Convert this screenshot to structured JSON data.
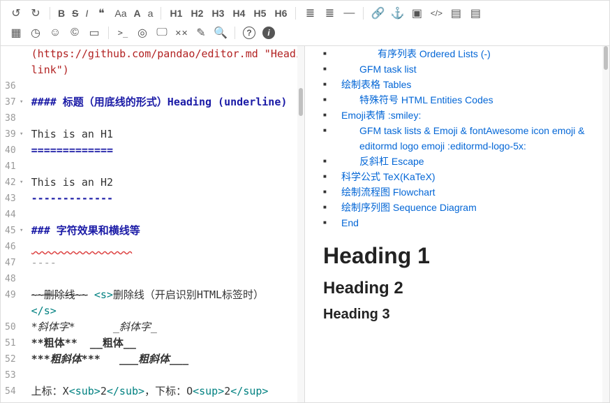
{
  "toolbar": {
    "undo": "↺",
    "redo": "↻",
    "bold": "B",
    "del": "S",
    "italic": "I",
    "quote": "❝",
    "ucwords": "Aa",
    "uppercase": "A",
    "lowercase": "a",
    "h1": "H1",
    "h2": "H2",
    "h3": "H3",
    "h4": "H4",
    "h5": "H5",
    "h6": "H6",
    "ul": "≣",
    "ol": "≣",
    "hr": "—",
    "link": "🔗",
    "anchor": "⚓",
    "image": "▣",
    "code": "</>",
    "codeblock": "▤",
    "codeblock2": "▤",
    "table": "▦",
    "datetime": "◷",
    "emoji": "☺",
    "copyright": "©",
    "htmlent": "▭",
    "goto": ">_",
    "watch": "◎",
    "preview": "🖵",
    "fullscreen": "✕✕",
    "clear": "✎",
    "search": "🔍",
    "help": "?",
    "info": "i"
  },
  "lines": [
    {
      "n": "",
      "fold": "",
      "parts": [
        {
          "cls": "c-link",
          "txt": "(https://github.com/pandao/editor.md \"Heading"
        }
      ]
    },
    {
      "n": "",
      "fold": "",
      "parts": [
        {
          "cls": "c-link",
          "txt": "link\")"
        }
      ]
    },
    {
      "n": "36",
      "fold": "",
      "parts": []
    },
    {
      "n": "37",
      "fold": "▾",
      "parts": [
        {
          "cls": "c-hdr",
          "txt": "#### 标题（用底线的形式）Heading (underline)"
        }
      ]
    },
    {
      "n": "38",
      "fold": "",
      "parts": []
    },
    {
      "n": "39",
      "fold": "▾",
      "parts": [
        {
          "cls": "",
          "txt": "This is an H1"
        }
      ]
    },
    {
      "n": "40",
      "fold": "",
      "parts": [
        {
          "cls": "c-hdr",
          "txt": "============="
        }
      ]
    },
    {
      "n": "41",
      "fold": "",
      "parts": []
    },
    {
      "n": "42",
      "fold": "▾",
      "parts": [
        {
          "cls": "",
          "txt": "This is an H2"
        }
      ]
    },
    {
      "n": "43",
      "fold": "",
      "parts": [
        {
          "cls": "c-hdr",
          "txt": "-------------"
        }
      ]
    },
    {
      "n": "44",
      "fold": "",
      "parts": []
    },
    {
      "n": "45",
      "fold": "▾",
      "parts": [
        {
          "cls": "c-hdr",
          "txt": "### 字符效果和横线等"
        }
      ]
    },
    {
      "n": "46",
      "fold": "",
      "parts": [
        {
          "cls": "squiggle",
          "txt": "                "
        }
      ]
    },
    {
      "n": "47",
      "fold": "",
      "parts": [
        {
          "cls": "c-hr",
          "txt": "----"
        }
      ]
    },
    {
      "n": "48",
      "fold": "",
      "parts": []
    },
    {
      "n": "49",
      "fold": "",
      "parts": [
        {
          "cls": "c-strike",
          "txt": "~~删除线~~"
        },
        {
          "cls": "",
          "txt": " "
        },
        {
          "cls": "c-tag",
          "txt": "<s>"
        },
        {
          "cls": "",
          "txt": "删除线（开启识别HTML标签时）"
        }
      ]
    },
    {
      "n": "",
      "fold": "",
      "parts": [
        {
          "cls": "c-tag",
          "txt": "</s>"
        }
      ]
    },
    {
      "n": "50",
      "fold": "",
      "parts": [
        {
          "cls": "c-em",
          "txt": "*斜体字*"
        },
        {
          "cls": "",
          "txt": "      "
        },
        {
          "cls": "c-em",
          "txt": "_斜体字_"
        }
      ]
    },
    {
      "n": "51",
      "fold": "",
      "parts": [
        {
          "cls": "c-strong",
          "txt": "**粗体**"
        },
        {
          "cls": "",
          "txt": "  "
        },
        {
          "cls": "c-strong",
          "txt": "__粗体__"
        }
      ]
    },
    {
      "n": "52",
      "fold": "",
      "parts": [
        {
          "cls": "c-strong c-em",
          "txt": "***粗斜体***"
        },
        {
          "cls": "",
          "txt": "   "
        },
        {
          "cls": "c-strong c-em",
          "txt": "___粗斜体___"
        }
      ]
    },
    {
      "n": "53",
      "fold": "",
      "parts": []
    },
    {
      "n": "54",
      "fold": "",
      "parts": [
        {
          "cls": "",
          "txt": "上标：X"
        },
        {
          "cls": "c-tag",
          "txt": "<sub>"
        },
        {
          "cls": "",
          "txt": "2"
        },
        {
          "cls": "c-tag",
          "txt": "</sub>"
        },
        {
          "cls": "",
          "txt": "，下标：O"
        },
        {
          "cls": "c-tag",
          "txt": "<sup>"
        },
        {
          "cls": "",
          "txt": "2"
        },
        {
          "cls": "c-tag",
          "txt": "</sup>"
        }
      ]
    }
  ],
  "toc": [
    {
      "level": 3,
      "label": "有序列表 Ordered Lists (-)"
    },
    {
      "level": 2,
      "label": "GFM task list"
    },
    {
      "level": 1,
      "label": "绘制表格 Tables"
    },
    {
      "level": 2,
      "label": "特殊符号 HTML Entities Codes"
    },
    {
      "level": 1,
      "label": "Emoji表情 :smiley:"
    },
    {
      "level": 2,
      "label": "GFM task lists & Emoji & fontAwesome icon emoji & editormd logo emoji :editormd-logo-5x:"
    },
    {
      "level": 2,
      "label": "反斜杠 Escape"
    },
    {
      "level": 1,
      "label": "科学公式 TeX(KaTeX)"
    },
    {
      "level": 1,
      "label": "绘制流程图 Flowchart"
    },
    {
      "level": 1,
      "label": "绘制序列图 Sequence Diagram"
    },
    {
      "level": 1,
      "label": "End"
    }
  ],
  "headings": {
    "h1": "Heading 1",
    "h2": "Heading 2",
    "h3": "Heading 3"
  }
}
